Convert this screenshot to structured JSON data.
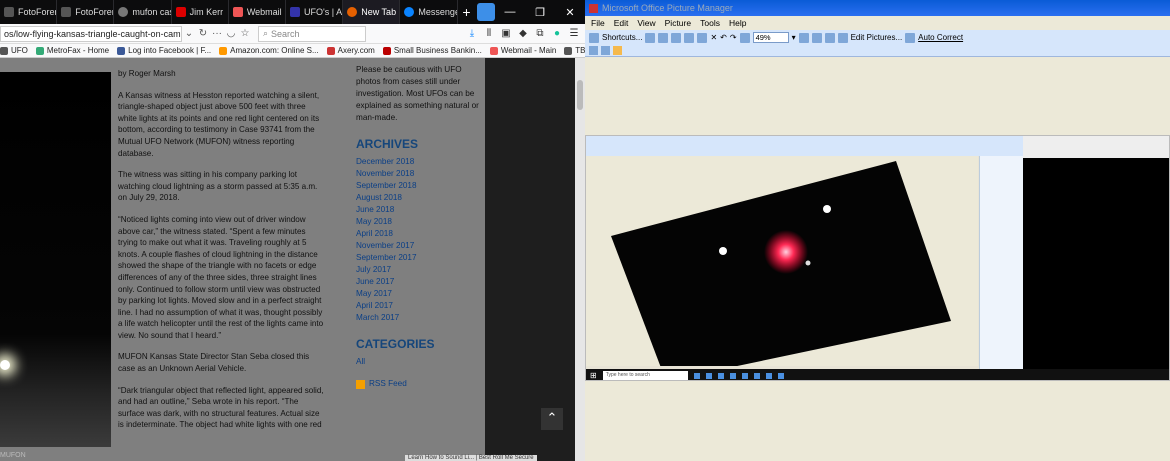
{
  "browser": {
    "tabs": [
      {
        "label": "FotoForen",
        "color": "#555"
      },
      {
        "label": "FotoForen",
        "color": "#555"
      },
      {
        "label": "mufon cas",
        "color": "#777"
      },
      {
        "label": "Jim Kerr",
        "color": "#d00"
      },
      {
        "label": "Webmail",
        "color": "#e55"
      },
      {
        "label": "UFO's | Au",
        "color": "#33a"
      },
      {
        "label": "New Tab",
        "color": "#e66000"
      },
      {
        "label": "Messenge",
        "color": "#0a84ff"
      }
    ],
    "url": "os/low-flying-kansas-triangle-caught-on-camera",
    "search_placeholder": "Search",
    "bookmarks": [
      {
        "label": "UFO",
        "color": "#555"
      },
      {
        "label": "MetroFax - Home",
        "color": "#3a7"
      },
      {
        "label": "Log into Facebook | F...",
        "color": "#3b5998"
      },
      {
        "label": "Amazon.com: Online S...",
        "color": "#f90"
      },
      {
        "label": "Axery.com",
        "color": "#c33"
      },
      {
        "label": "Small Business Bankin...",
        "color": "#b00"
      },
      {
        "label": "Webmail - Main",
        "color": "#e55"
      },
      {
        "label": "TBV INV.",
        "color": "#555"
      }
    ],
    "photo_caption": "MUFON",
    "article": {
      "byline": "by Roger Marsh",
      "paragraphs": [
        "A Kansas witness at Hesston reported watching a silent, triangle-shaped object just above 500 feet with three white lights at its points and one red light centered on its bottom, according to testimony in Case 93741 from the Mutual UFO Network (MUFON) witness reporting database.",
        "The witness was sitting in his company parking lot watching cloud lightning as a storm passed at 5:35 a.m. on July 29, 2018.",
        "“Noticed lights coming into view out of driver window above car,” the witness stated. “Spent a few minutes trying to make out what it was. Traveling roughly at 5 knots. A couple flashes of cloud lightning in the distance showed the shape of the triangle with no facets or edge differences of any of the three sides, three straight lines only. Continued to follow storm until view was obstructed by parking lot lights. Moved slow and in a perfect straight line. I had no assumption of what it was, thought possibly a life watch helicopter until the rest of the lights came into view. No sound that I heard.”",
        "MUFON Kansas State Director Stan Seba closed this case as an Unknown Aerial Vehicle.",
        "“Dark triangular object that reflected light, appeared solid, and had an outline,” Seba wrote in his report. “The surface was dark, with no structural features.  Actual size is indeterminate. The object had white lights with one red"
      ]
    },
    "sidebar": {
      "notice": "Please be cautious with UFO photos from cases still under investigation. Most UFOs can be explained as something natural or man-made.",
      "archives_title": "ARCHIVES",
      "archives": [
        "December 2018",
        "November 2018",
        "September 2018",
        "August 2018",
        "June 2018",
        "May 2018",
        "April 2018",
        "November 2017",
        "September 2017",
        "July 2017",
        "June 2017",
        "May 2017",
        "April 2017",
        "March 2017"
      ],
      "categories_title": "CATEGORIES",
      "categories": [
        "All"
      ],
      "rss": "RSS Feed"
    },
    "status": "Learn How to Sound Li... | Best Roll Me Secure"
  },
  "picture_manager": {
    "title": "Microsoft Office Picture Manager",
    "menus": [
      "File",
      "Edit",
      "View",
      "Picture",
      "Tools",
      "Help"
    ],
    "shortcuts": "Shortcuts...",
    "zoom": "49%",
    "edit_pictures": "Edit Pictures...",
    "auto_correct": "Auto Correct",
    "taskbar_search": "Type here to search"
  }
}
